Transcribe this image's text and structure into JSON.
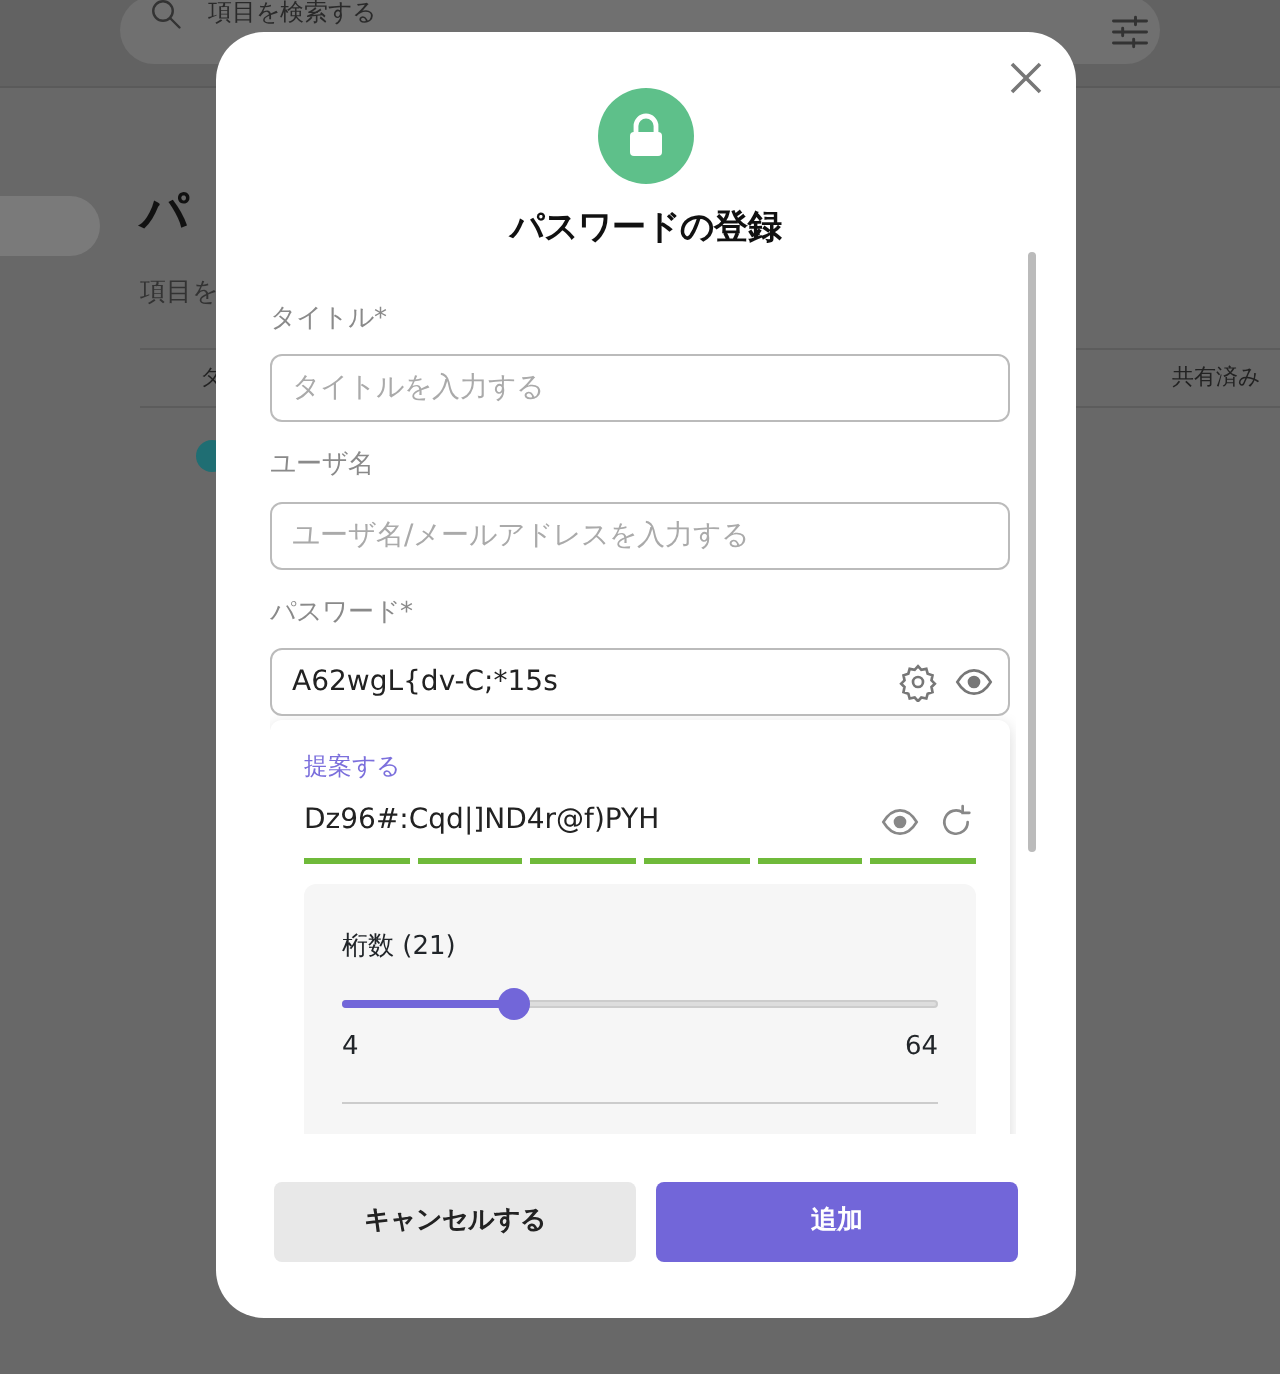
{
  "background": {
    "search": {
      "placeholder": "項目を検索する"
    },
    "heading": "パ",
    "subtitle": "項目を",
    "columns": [
      "タ",
      "共有済み"
    ],
    "rows": [
      {
        "color": "#1f6e73"
      }
    ]
  },
  "dialog": {
    "title": "パスワードの登録",
    "fields": [
      {
        "label": "タイトル*",
        "placeholder": "タイトルを入力する"
      },
      {
        "label": "ユーザ名",
        "placeholder": "ユーザ名/メールアドレスを入力する"
      },
      {
        "label": "パスワード*",
        "value": "A62wgL{dv-C;*15s"
      }
    ],
    "suggestion": {
      "label": "提案する",
      "password": "Dz96#:Cqd|]ND4r@f)PYH",
      "strength": {
        "level": 1
      },
      "length": {
        "label": "桁数 (21)",
        "level": 0.29,
        "min": "4",
        "max": "64"
      }
    },
    "buttons": [
      {
        "label": "キャンセルする",
        "kind": "secondary"
      },
      {
        "label": "追加",
        "kind": "primary"
      }
    ]
  }
}
